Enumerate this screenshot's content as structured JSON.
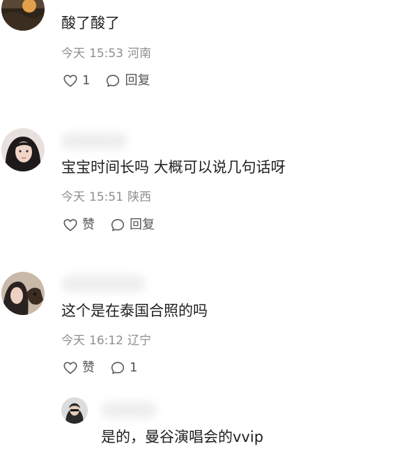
{
  "comments": [
    {
      "content": "酸了酸了",
      "date": "今天",
      "time": "15:53",
      "location": "河南",
      "like_label": "1",
      "reply_label": "回复"
    },
    {
      "content": "宝宝时间长吗 大概可以说几句话呀",
      "date": "今天",
      "time": "15:51",
      "location": "陕西",
      "like_label": "赞",
      "reply_label": "回复"
    },
    {
      "content": "这个是在泰国合照的吗",
      "date": "今天",
      "time": "16:12",
      "location": "辽宁",
      "like_label": "赞",
      "reply_label": "1"
    }
  ],
  "reply": {
    "content": "是的，曼谷演唱会的vvip"
  },
  "icons": {
    "like": "heart-icon",
    "reply": "comment-bubble-icon"
  },
  "colors": {
    "text": "#202020",
    "meta": "#8d8d8d",
    "action": "#555555"
  }
}
